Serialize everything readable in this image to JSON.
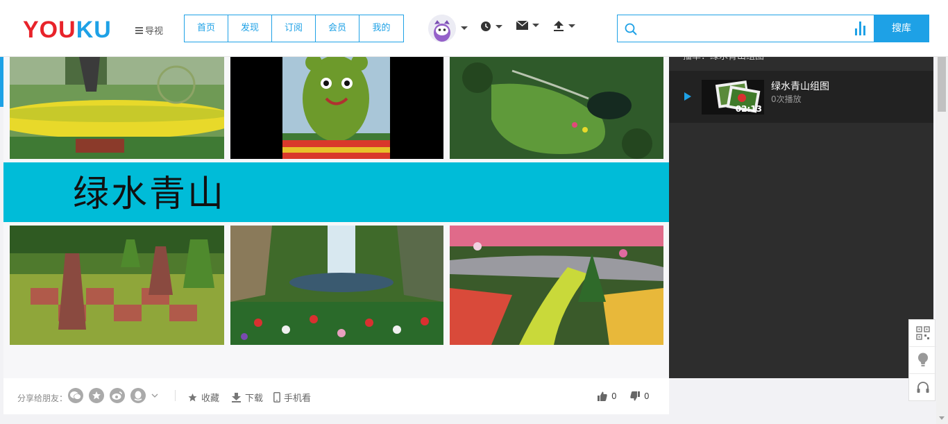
{
  "header": {
    "logo_red": "YOU",
    "logo_blue": "KU",
    "nav_toggle_label": "导视",
    "nav_tabs": [
      "首页",
      "发现",
      "订阅",
      "会员",
      "我的"
    ],
    "search": {
      "placeholder": "",
      "button_label": "搜库"
    }
  },
  "video": {
    "band_text": "绿水青山"
  },
  "playlist": {
    "header_text": "播单：绿水青山组图",
    "items": [
      {
        "title": "绿水青山组图",
        "plays": "0次播放",
        "duration": "02:13"
      }
    ]
  },
  "actions": {
    "share_label": "分享给朋友：",
    "collect_label": "收藏",
    "download_label": "下载",
    "mobile_label": "手机看",
    "likes": "0",
    "dislikes": "0"
  },
  "colors": {
    "accent": "#1ea1e6",
    "band": "#00bcd8",
    "logo_red": "#e8232a",
    "sidebar": "#2d2d2d"
  },
  "icons": [
    "menu-icon",
    "history-icon",
    "mail-icon",
    "upload-icon",
    "search-icon",
    "voice-icon",
    "play-icon",
    "wechat-icon",
    "star-icon",
    "weibo-icon",
    "qq-icon",
    "collect-icon",
    "download-icon",
    "mobile-icon",
    "thumbs-up-icon",
    "thumbs-down-icon",
    "qrcode-icon",
    "bulb-icon",
    "headset-icon"
  ]
}
